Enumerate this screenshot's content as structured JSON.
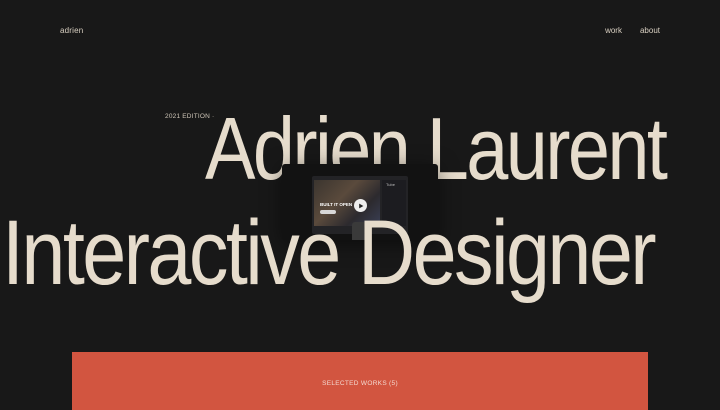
{
  "nav": {
    "logo": "adrien",
    "links": [
      "work",
      "about"
    ]
  },
  "hero": {
    "edition": "2021 EDITION ·",
    "line1": "Adrien Laurent",
    "line2": "Interactive Designer"
  },
  "video": {
    "tag": "BUILT IT OPEN",
    "side_label": "Tube",
    "play_icon": "play-icon"
  },
  "works": {
    "label": "SELECTED WORKS (5)",
    "color": "#d25540"
  },
  "colors": {
    "background": "#181818",
    "text": "#e6dccc",
    "accent": "#d25540"
  }
}
